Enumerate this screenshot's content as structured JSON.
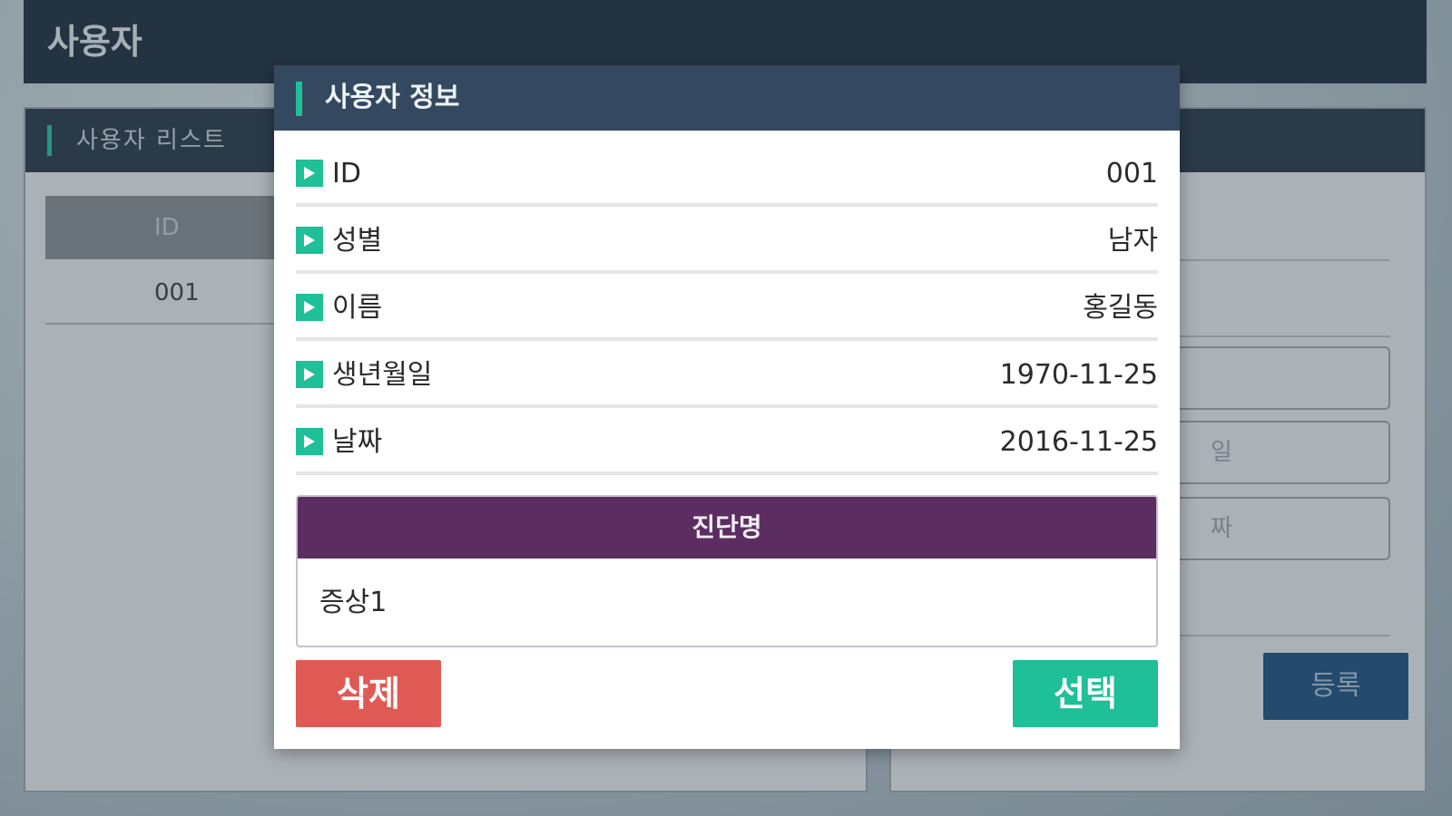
{
  "app": {
    "title": "사용자"
  },
  "user_list_panel": {
    "title": "사용자 리스트",
    "columns": [
      "ID"
    ],
    "rows": [
      [
        "001"
      ]
    ]
  },
  "register_panel": {
    "fields": [
      "",
      "",
      "",
      "일",
      "짜",
      ""
    ],
    "register_label": "등록"
  },
  "modal": {
    "title": "사용자 정보",
    "fields": [
      {
        "label": "ID",
        "value": "001"
      },
      {
        "label": "성별",
        "value": "남자"
      },
      {
        "label": "이름",
        "value": "홍길동"
      },
      {
        "label": "생년월일",
        "value": "1970-11-25"
      },
      {
        "label": "날짜",
        "value": "2016-11-25"
      }
    ],
    "diagnosis": {
      "title": "진단명",
      "value": "증상1"
    },
    "delete_label": "삭제",
    "select_label": "선택"
  },
  "colors": {
    "accent_green": "#1fbf97",
    "delete_red": "#e05a55",
    "diagnosis_purple": "#5c2d61",
    "modal_header": "#34495f"
  }
}
